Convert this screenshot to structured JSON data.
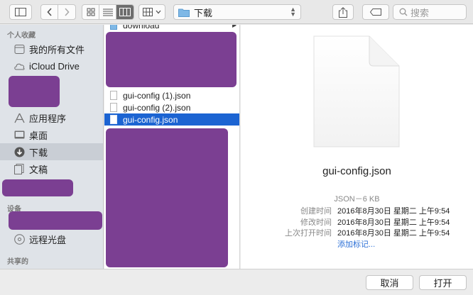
{
  "toolbar": {
    "path_label": "下载",
    "search_placeholder": "搜索"
  },
  "sidebar": {
    "favorites_header": "个人收藏",
    "devices_header": "设备",
    "shared_header": "共享的",
    "items": [
      {
        "label": "我的所有文件",
        "icon": "all-files-icon"
      },
      {
        "label": "iCloud Drive",
        "icon": "cloud-icon"
      },
      {
        "label": "应用程序",
        "icon": "applications-icon"
      },
      {
        "label": "桌面",
        "icon": "desktop-icon"
      },
      {
        "label": "下载",
        "icon": "download-icon"
      },
      {
        "label": "文稿",
        "icon": "documents-icon"
      }
    ],
    "device_items": [
      {
        "label": "远程光盘",
        "icon": "remote-disc-icon"
      }
    ]
  },
  "files": {
    "partial_top": "download",
    "rows": [
      {
        "name": "gui-config (1).json"
      },
      {
        "name": "gui-config (2).json"
      },
      {
        "name": "gui-config.json"
      }
    ]
  },
  "preview": {
    "filename": "gui-config.json",
    "kind": "JSON－6 KB",
    "meta": [
      {
        "key": "创建时间",
        "value": "2016年8月30日 星期二 上午9:54"
      },
      {
        "key": "修改时间",
        "value": "2016年8月30日 星期二 上午9:54"
      },
      {
        "key": "上次打开时间",
        "value": "2016年8月30日 星期二 上午9:54"
      }
    ],
    "add_tags": "添加标记..."
  },
  "buttons": {
    "cancel": "取消",
    "open": "打开"
  },
  "colors": {
    "selection": "#1c64d2",
    "redaction": "#7b3f92"
  }
}
